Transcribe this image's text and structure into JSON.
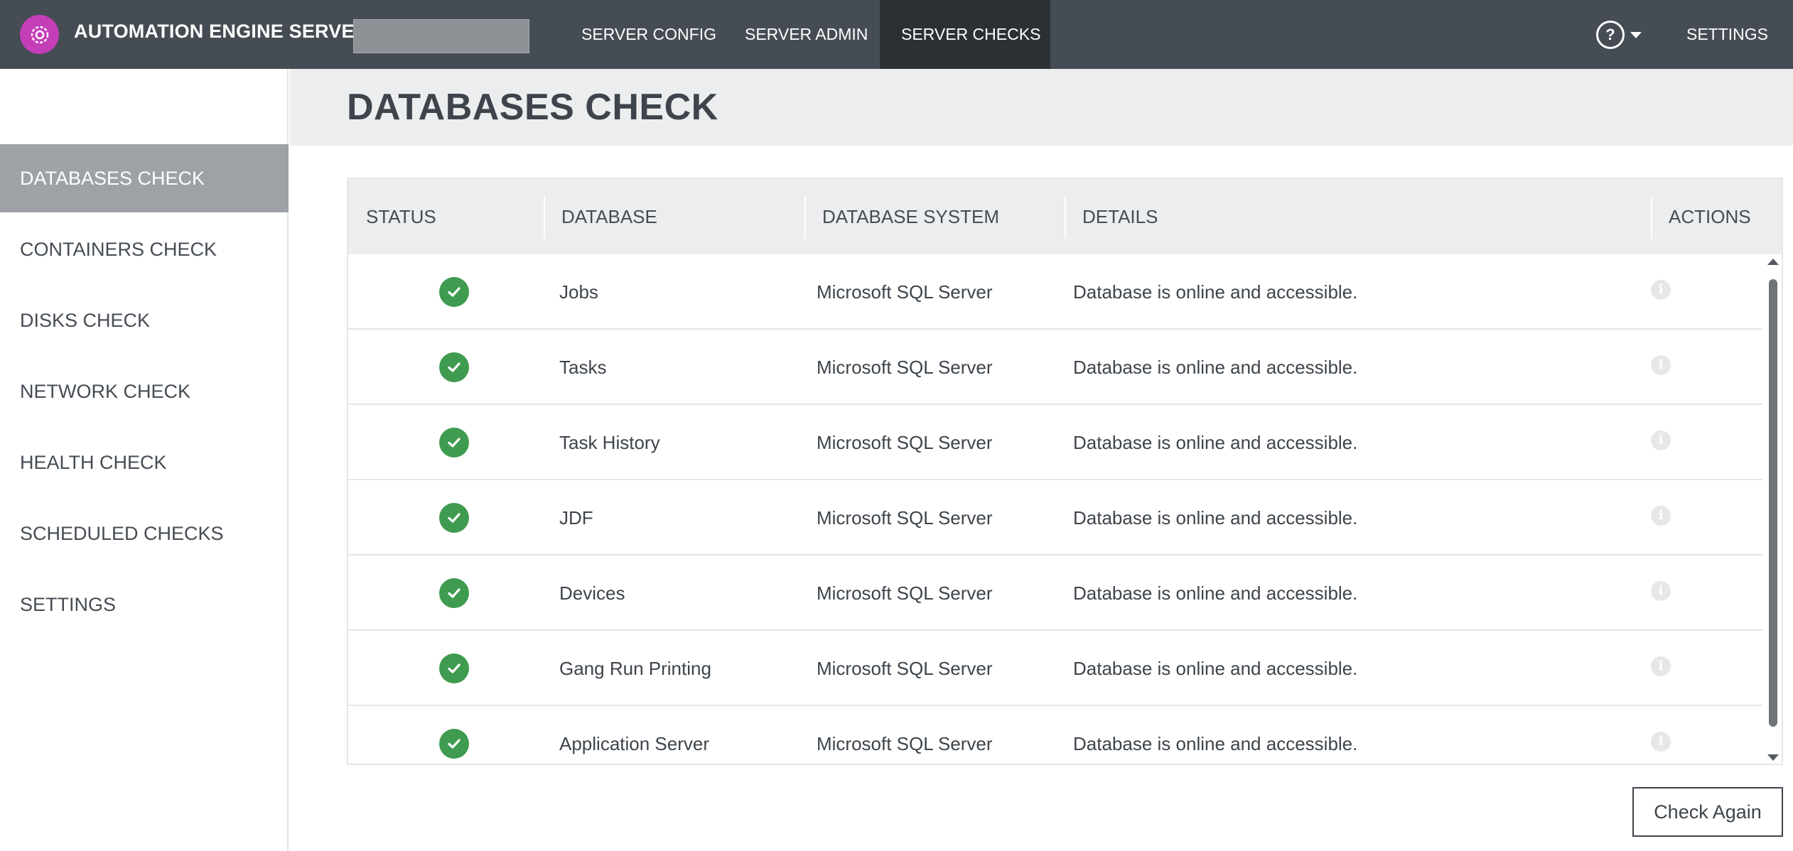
{
  "header": {
    "app_title": "AUTOMATION ENGINE SERVER -",
    "tabs": [
      {
        "label": "SERVER CONFIG"
      },
      {
        "label": "SERVER ADMIN"
      },
      {
        "label": "SERVER CHECKS"
      }
    ],
    "help_glyph": "?",
    "settings_label": "SETTINGS"
  },
  "sidebar": {
    "items": [
      {
        "label": "DATABASES CHECK"
      },
      {
        "label": "CONTAINERS CHECK"
      },
      {
        "label": "DISKS CHECK"
      },
      {
        "label": "NETWORK CHECK"
      },
      {
        "label": "HEALTH CHECK"
      },
      {
        "label": "SCHEDULED CHECKS"
      },
      {
        "label": "SETTINGS"
      }
    ]
  },
  "main": {
    "title": "DATABASES CHECK",
    "columns": [
      "STATUS",
      "DATABASE",
      "DATABASE SYSTEM",
      "DETAILS",
      "ACTIONS"
    ],
    "rows": [
      {
        "database": "Jobs",
        "system": "Microsoft SQL Server",
        "details": "Database is online and accessible."
      },
      {
        "database": "Tasks",
        "system": "Microsoft SQL Server",
        "details": "Database is online and accessible."
      },
      {
        "database": "Task History",
        "system": "Microsoft SQL Server",
        "details": "Database is online and accessible."
      },
      {
        "database": "JDF",
        "system": "Microsoft SQL Server",
        "details": "Database is online and accessible."
      },
      {
        "database": "Devices",
        "system": "Microsoft SQL Server",
        "details": "Database is online and accessible."
      },
      {
        "database": "Gang Run Printing",
        "system": "Microsoft SQL Server",
        "details": "Database is online and accessible."
      },
      {
        "database": "Application Server",
        "system": "Microsoft SQL Server",
        "details": "Database is online and accessible."
      }
    ],
    "info_glyph": "i",
    "check_again_label": "Check Again"
  },
  "colors": {
    "topbar": "#454c54",
    "active_tab": "#2b3035",
    "logo": "#c43eb8",
    "status_ok": "#3f9b4f",
    "sidebar_active": "#9ea2a6"
  }
}
